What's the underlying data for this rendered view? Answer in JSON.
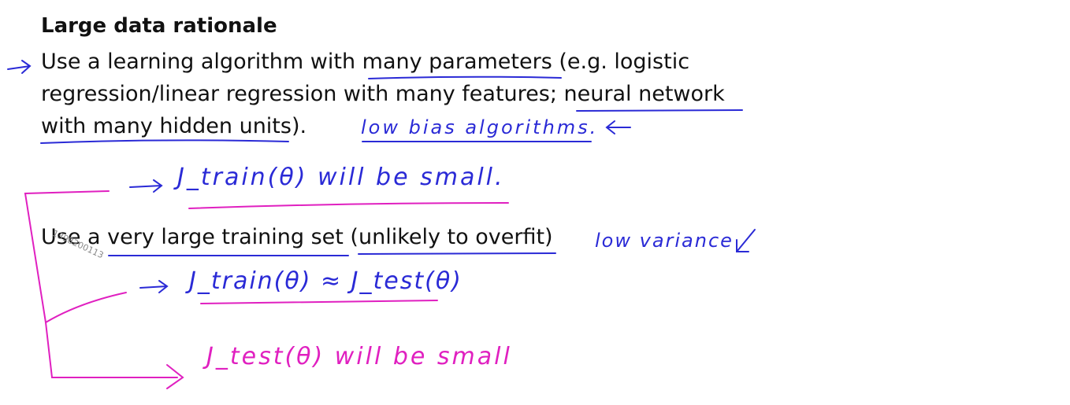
{
  "slide": {
    "title": "Large data rationale",
    "bullet1_lines": [
      "Use a learning algorithm with many parameters (e.g. logistic",
      "regression/linear regression with many features; neural network",
      "with many hidden units)."
    ],
    "bullet2": "Use a very large training set (unlikely to overfit)"
  },
  "annotations": {
    "low_bias": "low bias algorithms.",
    "jtrain_small": "J_train(θ) will be small.",
    "low_variance": "low variance",
    "jtrain_approx_jtest": "J_train(θ) ≈ J_test(θ)",
    "jtest_small": "J_test(θ) will be small"
  },
  "watermark": "1398200113",
  "colors": {
    "ink_blue": "#2a2ad6",
    "ink_pink": "#e020c0",
    "text": "#111111"
  }
}
